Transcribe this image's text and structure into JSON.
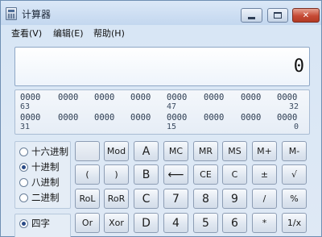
{
  "window": {
    "title": "计算器"
  },
  "menu": {
    "view": "查看(V)",
    "edit": "编辑(E)",
    "help": "帮助(H)"
  },
  "display": {
    "value": "0"
  },
  "bits": {
    "row1": [
      "0000",
      "0000",
      "0000",
      "0000",
      "0000",
      "0000",
      "0000",
      "0000"
    ],
    "row1_labels": {
      "left": "63",
      "mid": "47",
      "right": "32"
    },
    "row2": [
      "0000",
      "0000",
      "0000",
      "0000",
      "0000",
      "0000",
      "0000",
      "0000"
    ],
    "row2_labels": {
      "left": "31",
      "mid": "15",
      "right": "0"
    }
  },
  "base_modes": [
    {
      "label": "十六进制",
      "selected": false
    },
    {
      "label": "十进制",
      "selected": true
    },
    {
      "label": "八进制",
      "selected": false
    },
    {
      "label": "二进制",
      "selected": false
    }
  ],
  "word_modes": [
    {
      "label": "四字",
      "selected": true
    }
  ],
  "keys": {
    "row1": [
      "",
      "Mod",
      "A",
      "MC",
      "MR",
      "MS",
      "M+",
      "M-"
    ],
    "row2": [
      "(",
      ")",
      "B",
      "⟵",
      "CE",
      "C",
      "±",
      "√"
    ],
    "row3": [
      "RoL",
      "RoR",
      "C",
      "7",
      "8",
      "9",
      "/",
      "%"
    ],
    "row4": [
      "Or",
      "Xor",
      "D",
      "4",
      "5",
      "6",
      "*",
      "1/x"
    ]
  }
}
